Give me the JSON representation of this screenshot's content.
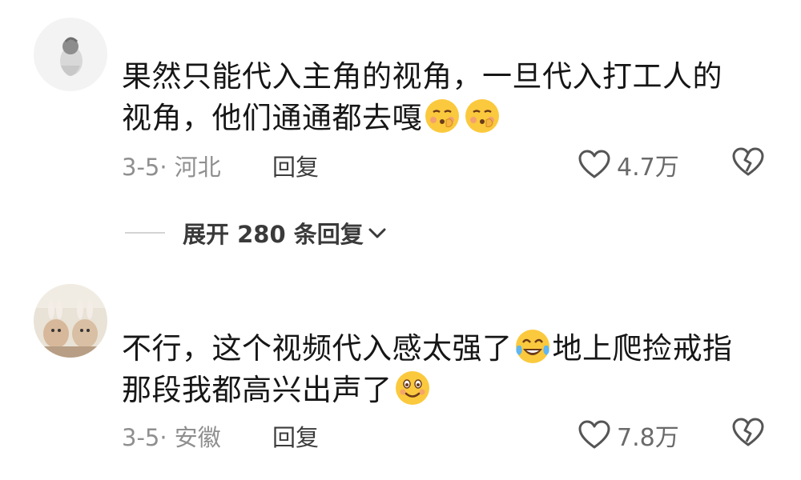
{
  "comments": [
    {
      "text_line1": "果然只能代入主角的视角，一旦代入打工人的",
      "text_line2": "视角，他们通通都去嘎",
      "meta": "3-5· 河北",
      "reply_label": "回复",
      "like_count": "4.7万",
      "emoji": "shushing-face-emoji"
    },
    {
      "text_line1_a": "不行，这个视频代入感太强了",
      "text_line1_b": "地上爬捡戒指",
      "text_line2": "那段我都高兴出声了",
      "meta": "3-5· 安徽",
      "reply_label": "回复",
      "like_count": "7.8万",
      "emoji_a": "tears-of-joy-emoji",
      "emoji_b": "smiling-face-emoji"
    }
  ],
  "expand_replies": {
    "label": "展开 280 条回复"
  },
  "colors": {
    "text": "#161616",
    "meta": "#8f8f8f",
    "emoji_yellow": "#fbc93d",
    "emoji_blush": "#f2967d"
  }
}
